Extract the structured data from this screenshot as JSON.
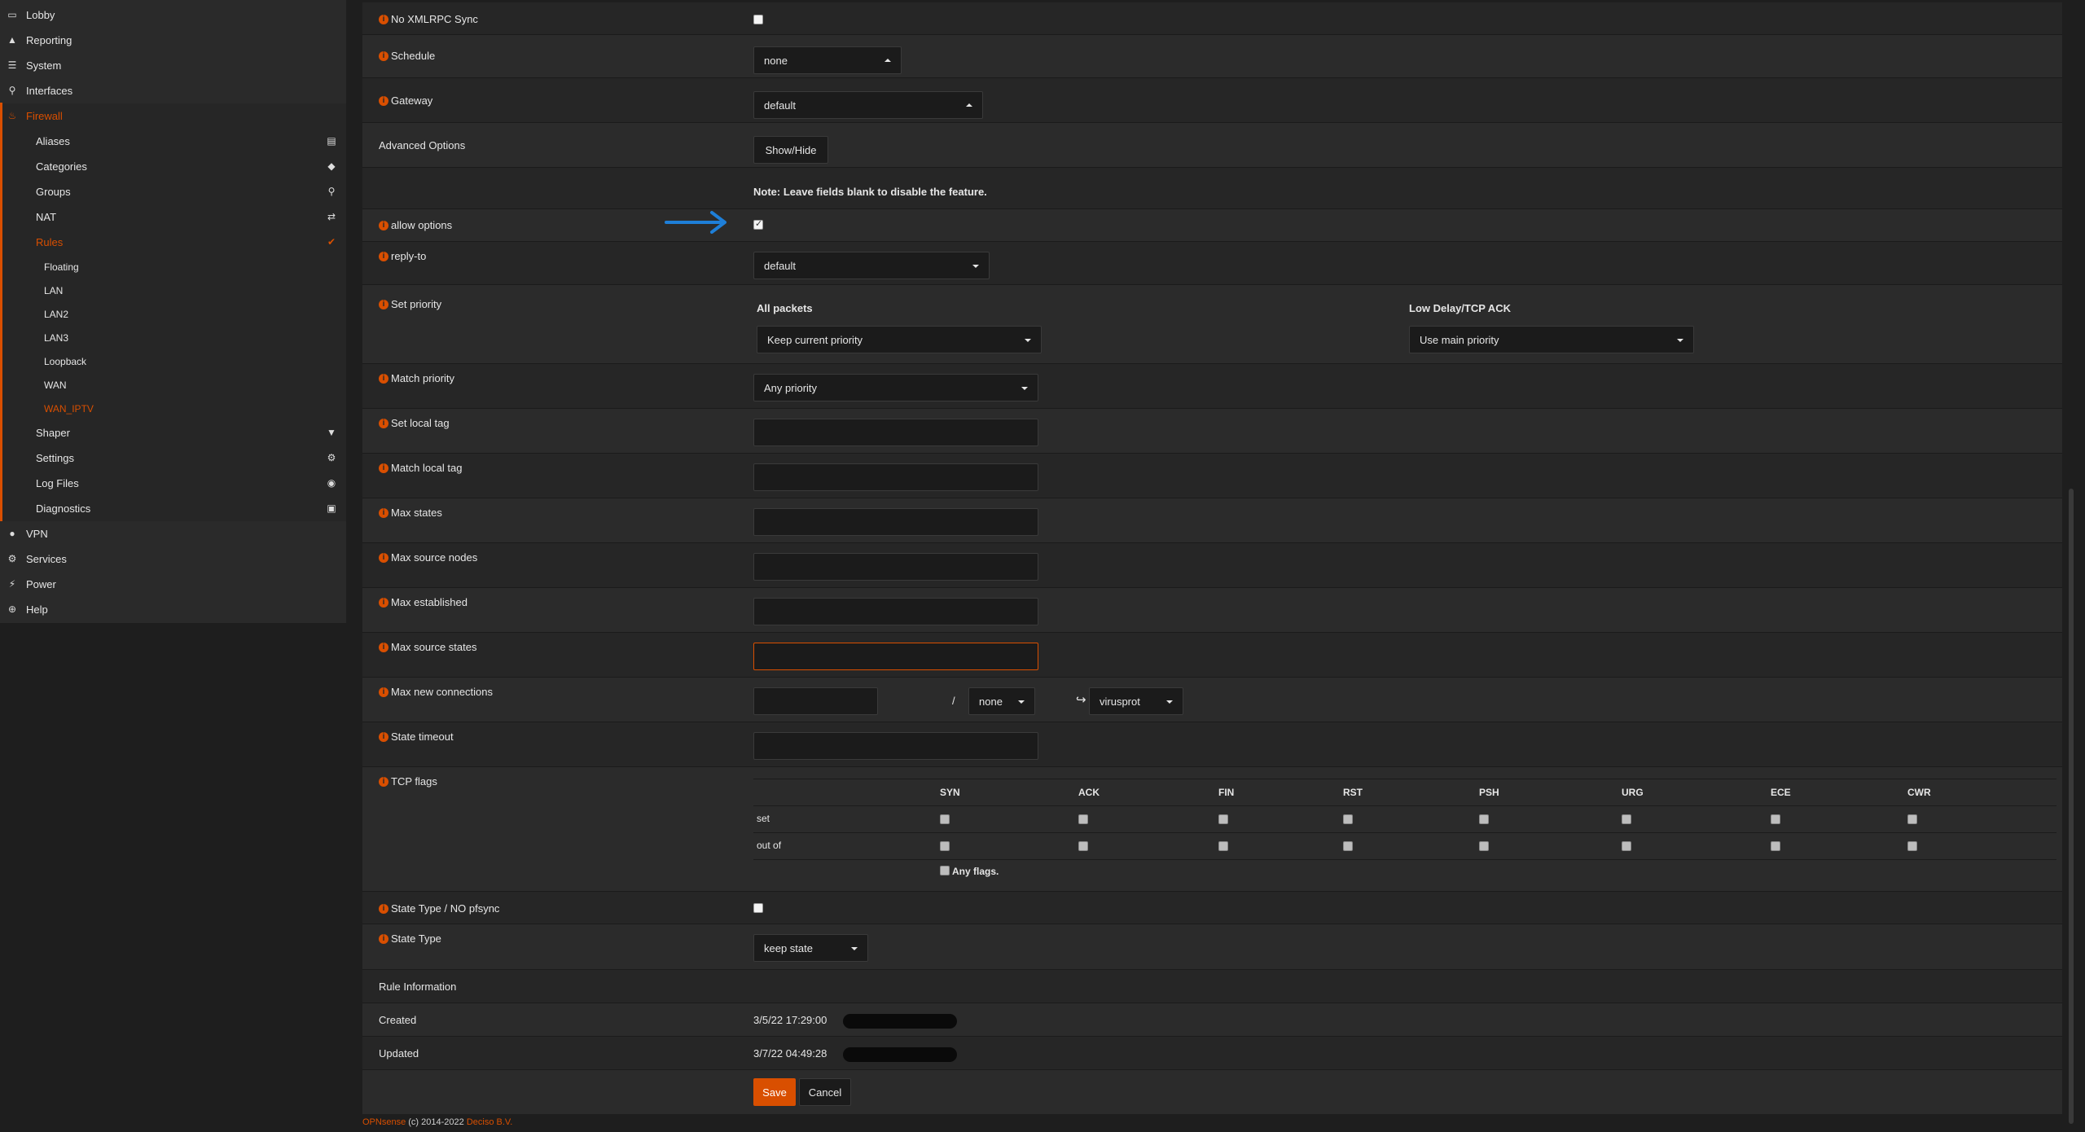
{
  "sidebar": {
    "items": [
      {
        "label": "Lobby",
        "icon": "laptop-icon"
      },
      {
        "label": "Reporting",
        "icon": "area-chart-icon"
      },
      {
        "label": "System",
        "icon": "list-icon"
      },
      {
        "label": "Interfaces",
        "icon": "sitemap-icon"
      },
      {
        "label": "Firewall",
        "icon": "fire-icon"
      },
      {
        "label": "Aliases",
        "icon": "list-alt-icon"
      },
      {
        "label": "Categories",
        "icon": "tags-icon"
      },
      {
        "label": "Groups",
        "icon": "sitemap-icon"
      },
      {
        "label": "NAT",
        "icon": "exchange-icon"
      },
      {
        "label": "Rules",
        "icon": "check-icon"
      },
      {
        "label": "Floating"
      },
      {
        "label": "LAN"
      },
      {
        "label": "LAN2"
      },
      {
        "label": "LAN3"
      },
      {
        "label": "Loopback"
      },
      {
        "label": "WAN"
      },
      {
        "label": "WAN_IPTV"
      },
      {
        "label": "Shaper",
        "icon": "filter-icon"
      },
      {
        "label": "Settings",
        "icon": "cogs-icon"
      },
      {
        "label": "Log Files",
        "icon": "eye-icon"
      },
      {
        "label": "Diagnostics",
        "icon": "medkit-icon"
      },
      {
        "label": "VPN",
        "icon": "globe-icon"
      },
      {
        "label": "Services",
        "icon": "cog-icon"
      },
      {
        "label": "Power",
        "icon": "plug-icon"
      },
      {
        "label": "Help",
        "icon": "life-ring-icon"
      }
    ]
  },
  "form": {
    "no_xmlrpc_sync": {
      "label": "No XMLRPC Sync",
      "checked": false
    },
    "schedule": {
      "label": "Schedule",
      "value": "none"
    },
    "gateway": {
      "label": "Gateway",
      "value": "default"
    },
    "advanced_options": {
      "label": "Advanced Options",
      "button": "Show/Hide"
    },
    "note": "Note: Leave fields blank to disable the feature.",
    "allow_options": {
      "label": "allow options",
      "checked": true
    },
    "reply_to": {
      "label": "reply-to",
      "value": "default"
    },
    "set_priority": {
      "label": "Set priority",
      "all_packets_label": "All packets",
      "all_packets_value": "Keep current priority",
      "low_delay_label": "Low Delay/TCP ACK",
      "low_delay_value": "Use main priority"
    },
    "match_priority": {
      "label": "Match priority",
      "value": "Any priority"
    },
    "set_local_tag": {
      "label": "Set local tag",
      "value": ""
    },
    "match_local_tag": {
      "label": "Match local tag",
      "value": ""
    },
    "max_states": {
      "label": "Max states",
      "value": ""
    },
    "max_source_nodes": {
      "label": "Max source nodes",
      "value": ""
    },
    "max_established": {
      "label": "Max established",
      "value": ""
    },
    "max_source_states": {
      "label": "Max source states",
      "value": ""
    },
    "max_new_connections": {
      "label": "Max new connections",
      "value": "",
      "separator": "/",
      "interval": "none",
      "table": "virusprot"
    },
    "state_timeout": {
      "label": "State timeout",
      "value": ""
    },
    "tcp_flags": {
      "label": "TCP flags",
      "columns": [
        "SYN",
        "ACK",
        "FIN",
        "RST",
        "PSH",
        "URG",
        "ECE",
        "CWR"
      ],
      "row_set": "set",
      "row_out_of": "out of",
      "any_flags": "Any flags."
    },
    "state_type_no_pfsync": {
      "label": "State Type / NO pfsync",
      "checked": false
    },
    "state_type": {
      "label": "State Type",
      "value": "keep state"
    },
    "rule_information": {
      "label": "Rule Information"
    },
    "created": {
      "label": "Created",
      "value": "3/5/22 17:29:00"
    },
    "updated": {
      "label": "Updated",
      "value": "3/7/22 04:49:28"
    },
    "save": "Save",
    "cancel": "Cancel"
  },
  "footer": {
    "brand": "OPNsense",
    "copyright": "(c) 2014-2022",
    "company": "Deciso B.V."
  },
  "colors": {
    "accent": "#d94f00",
    "arrow": "#1e7fd8"
  }
}
